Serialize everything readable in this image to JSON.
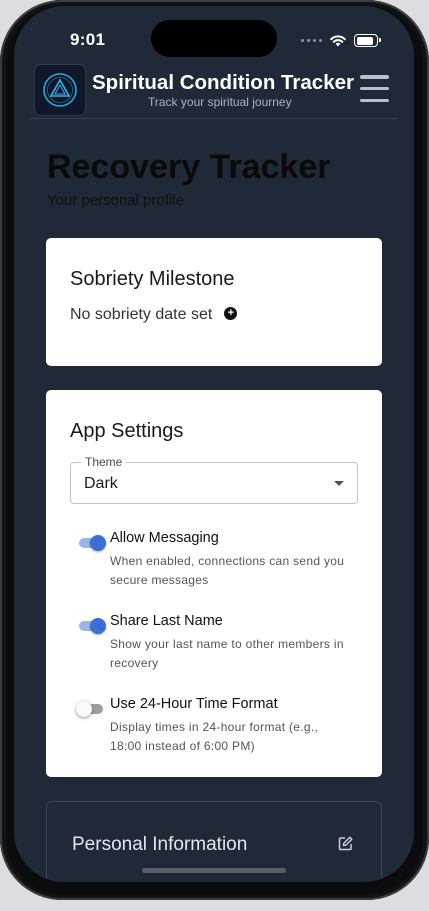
{
  "status_bar": {
    "time": "9:01",
    "icons": [
      "signal-dots-icon",
      "wifi-icon",
      "battery-icon"
    ]
  },
  "header": {
    "title": "Spiritual Condition Tracker",
    "subtitle": "Track your spiritual journey",
    "logo_icon": "app-logo-icon",
    "menu_icon": "hamburger-menu-icon"
  },
  "page": {
    "title": "Recovery Tracker",
    "subtitle": "Your personal profile"
  },
  "milestone": {
    "title": "Sobriety Milestone",
    "empty_text": "No sobriety date set",
    "add_icon": "add-circle-icon"
  },
  "settings": {
    "title": "App Settings",
    "theme": {
      "label": "Theme",
      "value": "Dark"
    },
    "toggles": [
      {
        "label": "Allow Messaging",
        "description": "When enabled, connections can send you secure messages",
        "enabled": true
      },
      {
        "label": "Share Last Name",
        "description": "Show your last name to other members in recovery",
        "enabled": true
      },
      {
        "label": "Use 24-Hour Time Format",
        "description": "Display times in 24-hour format (e.g., 18:00 instead of 6:00 PM)",
        "enabled": false
      }
    ]
  },
  "personal_info": {
    "title": "Personal Information",
    "edit_icon": "edit-icon"
  },
  "colors": {
    "background": "#1f2937",
    "card": "#ffffff",
    "accent": "#3b6fd6",
    "divider": "#374151"
  }
}
